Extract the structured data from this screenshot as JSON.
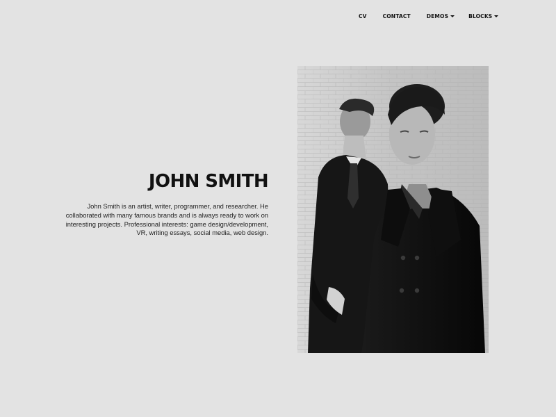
{
  "nav": {
    "items": [
      {
        "label": "CV",
        "dropdown": false
      },
      {
        "label": "CONTACT",
        "dropdown": false
      },
      {
        "label": "DEMOS",
        "dropdown": true
      },
      {
        "label": "BLOCKS",
        "dropdown": true
      }
    ]
  },
  "hero": {
    "title": "JOHN SMITH",
    "description": "John Smith is an artist, writer, programmer, and researcher. He collaborated with many famous brands and is always ready to work on interesting projects. Professional interests: game design/development, VR, writing essays, social media,  web design."
  },
  "photo": {
    "style": "black-and-white portrait",
    "subjects": 2
  },
  "colors": {
    "background": "#e3e3e3",
    "text": "#111111"
  }
}
